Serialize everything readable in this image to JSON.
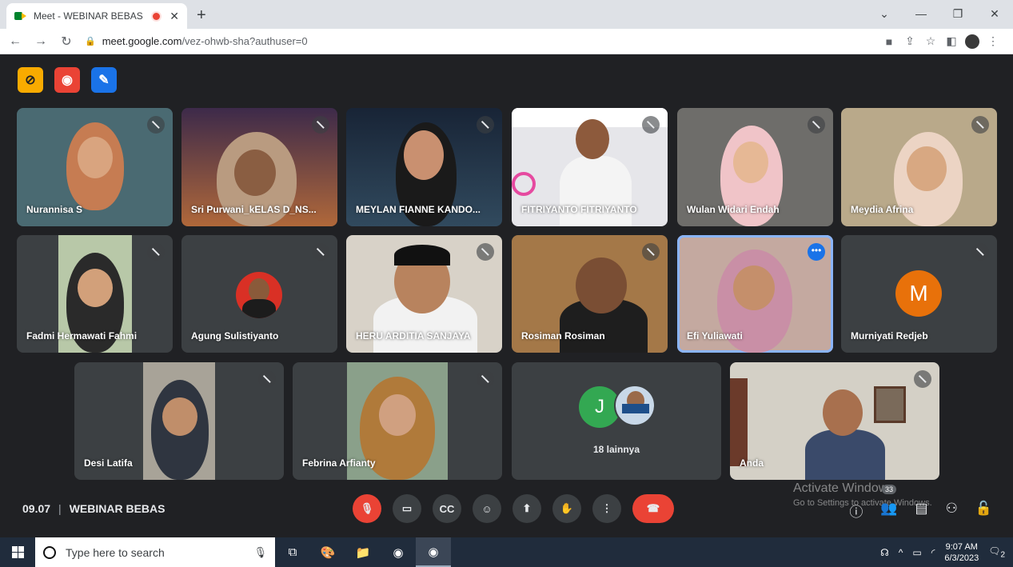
{
  "browser": {
    "tab_title": "Meet - WEBINAR BEBAS",
    "url_host": "meet.google.com",
    "url_path": "/vez-ohwb-sha?authuser=0"
  },
  "tiles": [
    {
      "name": "Nurannisa S"
    },
    {
      "name": "Sri Purwani_kELAS D_NS..."
    },
    {
      "name": "MEYLAN FIANNE KANDO..."
    },
    {
      "name": "FITRIYANTO FITRIYANTO"
    },
    {
      "name": "Wulan Widari Endah"
    },
    {
      "name": "Meydia Afrina"
    },
    {
      "name": "Fadmi Hermawati Fahmi"
    },
    {
      "name": "Agung Sulistiyanto"
    },
    {
      "name": "HERU ARDITIA SANJAYA"
    },
    {
      "name": "Rosiman Rosiman"
    },
    {
      "name": "Efi Yuliawati"
    },
    {
      "name": "Murniyati Redjeb",
      "initial": "M"
    },
    {
      "name": "Desi Latifa"
    },
    {
      "name": "Febrina Arfianty"
    },
    {
      "name": "18 lainnya",
      "initial": "J"
    },
    {
      "name": "Anda"
    }
  ],
  "meeting": {
    "time": "09.07",
    "title": "WEBINAR BEBAS",
    "participants_count": "33"
  },
  "watermark": {
    "line1": "Activate Windows",
    "line2": "Go to Settings to activate Windows."
  },
  "taskbar": {
    "search_placeholder": "Type here to search",
    "time": "9:07 AM",
    "date": "6/3/2023",
    "notif_count": "2"
  }
}
